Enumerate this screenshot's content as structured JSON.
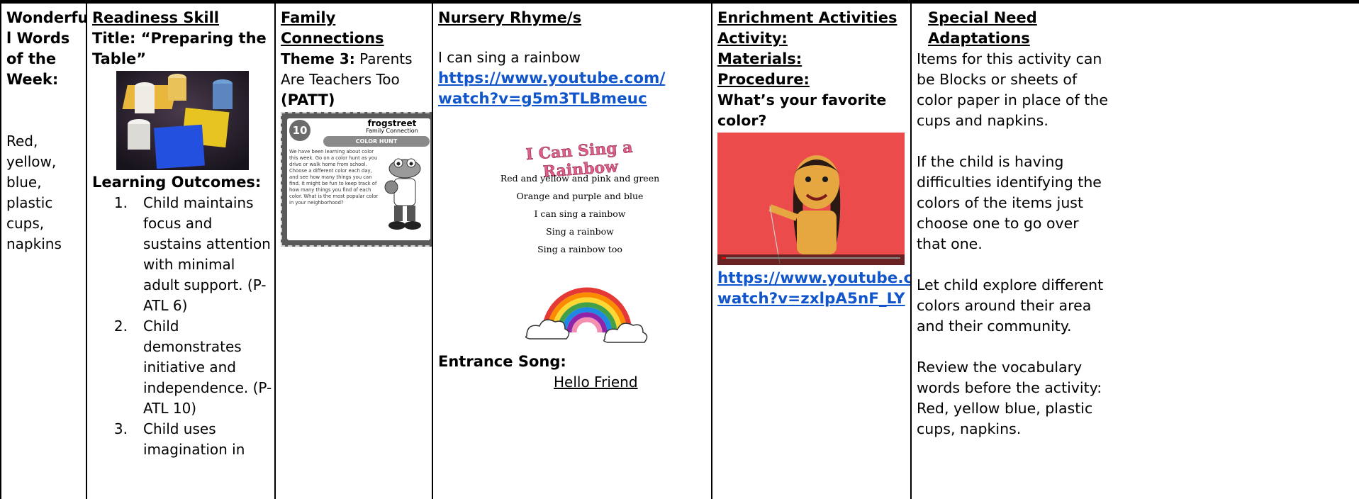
{
  "col1": {
    "title": "Wonderfu l Words of the Week:",
    "words": "Red, yellow, blue, plastic cups, napkins"
  },
  "col2": {
    "heading": "Readiness Skill",
    "title": "Title: “Preparing the Table”",
    "outcomes_heading": "Learning Outcomes:",
    "outcomes": [
      {
        "n": "1.",
        "text": "Child maintains focus and sustains attention with minimal adult support. (P-ATL 6)"
      },
      {
        "n": "2.",
        "text": "Child demonstrates initiative and independence. (P-ATL 10)"
      },
      {
        "n": "3.",
        "text": "Child uses imagination in"
      }
    ]
  },
  "col3": {
    "heading": "Family Connections",
    "theme_label": "Theme 3:",
    "theme_text": "Parents Are Teachers Too",
    "patt": "(PATT)",
    "card": {
      "number": "10",
      "brand": "frogstreet",
      "subtitle": "Family Connection",
      "banner": "COLOR HUNT",
      "body": "We have been learning about color this week. Go on a color hunt as you drive or walk home from school. Choose a different color each day, and see how many things you can find. It might be fun to keep track of how many things you find of each color. What is the most popular color in your neighborhood?"
    }
  },
  "col4": {
    "heading": "Nursery Rhyme/s",
    "line1": "I can sing a rainbow",
    "link": "https://www.youtube.com/watch?v=g5m3TLBmeuc",
    "link_l1": "https://www.youtube.com/",
    "link_l2": "watch?v=g5m3TLBmeuc",
    "poster_title": "I Can Sing a Rainbow",
    "lyrics": [
      "Red and yellow and pink and green",
      "Orange and purple and blue",
      "I can sing a rainbow",
      "Sing a rainbow",
      "Sing a rainbow too"
    ],
    "entrance_label": "Entrance Song:",
    "entrance_song": "Hello Friend"
  },
  "col5": {
    "heading": "Enrichment Activities",
    "activity": "Activity:",
    "materials": "Materials:",
    "procedure": "Procedure:",
    "question": "What’s your favorite color?",
    "link_l1": "https://www.youtube.com/",
    "link_l2": "watch?v=zxlpA5nF_LY"
  },
  "col6": {
    "heading": "Special Need Adaptations",
    "p1": "Items for this activity can be Blocks or sheets of color paper in place of the cups and napkins.",
    "p2": "If the child is having difficulties identifying the colors of the items just choose one to go over that one.",
    "p3": "Let child explore different colors around their area and their community.",
    "p4": "Review the vocabulary words before the activity: Red, yellow blue, plastic cups, napkins."
  },
  "colors": {
    "link": "#1155cc",
    "video_bg": "#ec4b4b",
    "puppet": "#e6a640"
  }
}
